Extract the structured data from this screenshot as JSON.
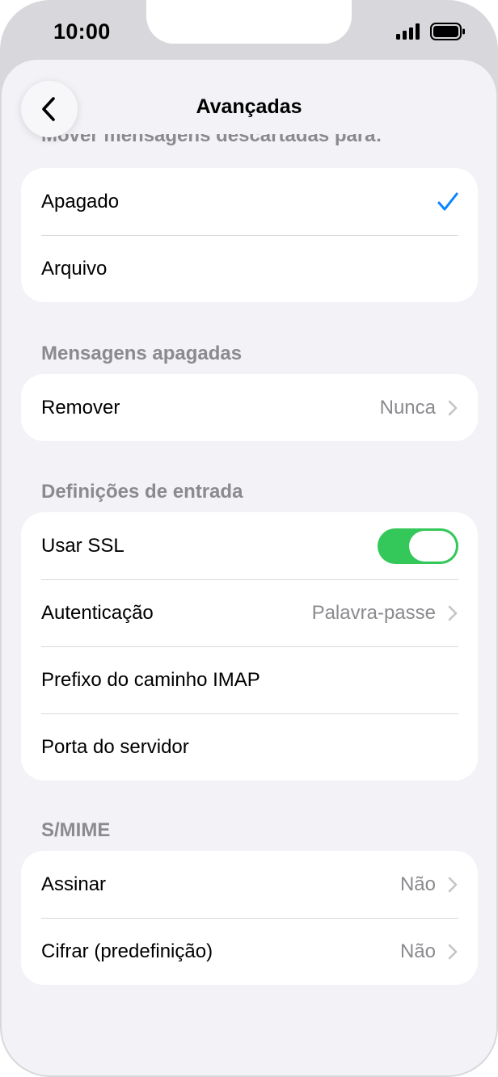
{
  "status_bar": {
    "time": "10:00"
  },
  "nav": {
    "title": "Avançadas",
    "back_icon": "chevron-left-icon"
  },
  "sections": {
    "move_discarded": {
      "header": "Mover mensagens descartadas para:",
      "options": [
        {
          "label": "Apagado",
          "selected": true
        },
        {
          "label": "Arquivo",
          "selected": false
        }
      ]
    },
    "deleted_messages": {
      "header": "Mensagens apagadas",
      "rows": [
        {
          "label": "Remover",
          "value": "Nunca"
        }
      ]
    },
    "incoming_settings": {
      "header": "Definições de entrada",
      "use_ssl": {
        "label": "Usar SSL",
        "on": true
      },
      "authentication": {
        "label": "Autenticação",
        "value": "Palavra-passe"
      },
      "imap_prefix": {
        "label": "Prefixo do caminho IMAP"
      },
      "server_port": {
        "label": "Porta do servidor"
      }
    },
    "smime": {
      "header": "S/MIME",
      "rows": [
        {
          "label": "Assinar",
          "value": "Não"
        },
        {
          "label": "Cifrar (predefinição)",
          "value": "Não"
        }
      ]
    }
  },
  "colors": {
    "accent": "#0a84ff",
    "toggle_on": "#34c759",
    "secondary_text": "#8a8a8f"
  }
}
